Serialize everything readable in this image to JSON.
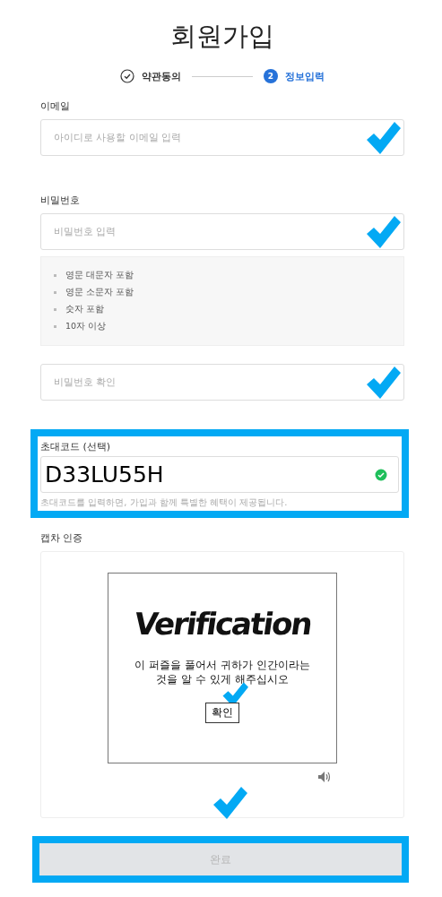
{
  "title": "회원가입",
  "steps": [
    {
      "label": "약관동의",
      "kind": "done",
      "selected": false
    },
    {
      "label": "정보입력",
      "kind": "number",
      "number": "2",
      "selected": true
    }
  ],
  "email": {
    "label": "이메일",
    "placeholder": "아이디로 사용할 이메일 입력",
    "marked": true
  },
  "password": {
    "label": "비밀번호",
    "placeholder": "비밀번호 입력",
    "marked": true,
    "rules": [
      "영문 대문자 포함",
      "영문 소문자 포함",
      "숫자 포함",
      "10자 이상"
    ]
  },
  "password_confirm": {
    "placeholder": "비밀번호 확인",
    "marked": true
  },
  "invite": {
    "label": "초대코드 (선택)",
    "value": "D33LU55H",
    "valid": true,
    "hint": "초대코드를 입력하면, 가입과 함께 특별한 혜택이 제공됩니다.",
    "highlighted": true
  },
  "captcha": {
    "label": "캡차 인증",
    "image_text": "Verification",
    "message": "이 퍼즐을 풀어서 귀하가 인간이라는 것을 알 수 있게 해주십시오",
    "button": "확인",
    "button_marked": true
  },
  "submit": {
    "label": "완료",
    "disabled": true,
    "highlighted": true,
    "marked": true
  }
}
